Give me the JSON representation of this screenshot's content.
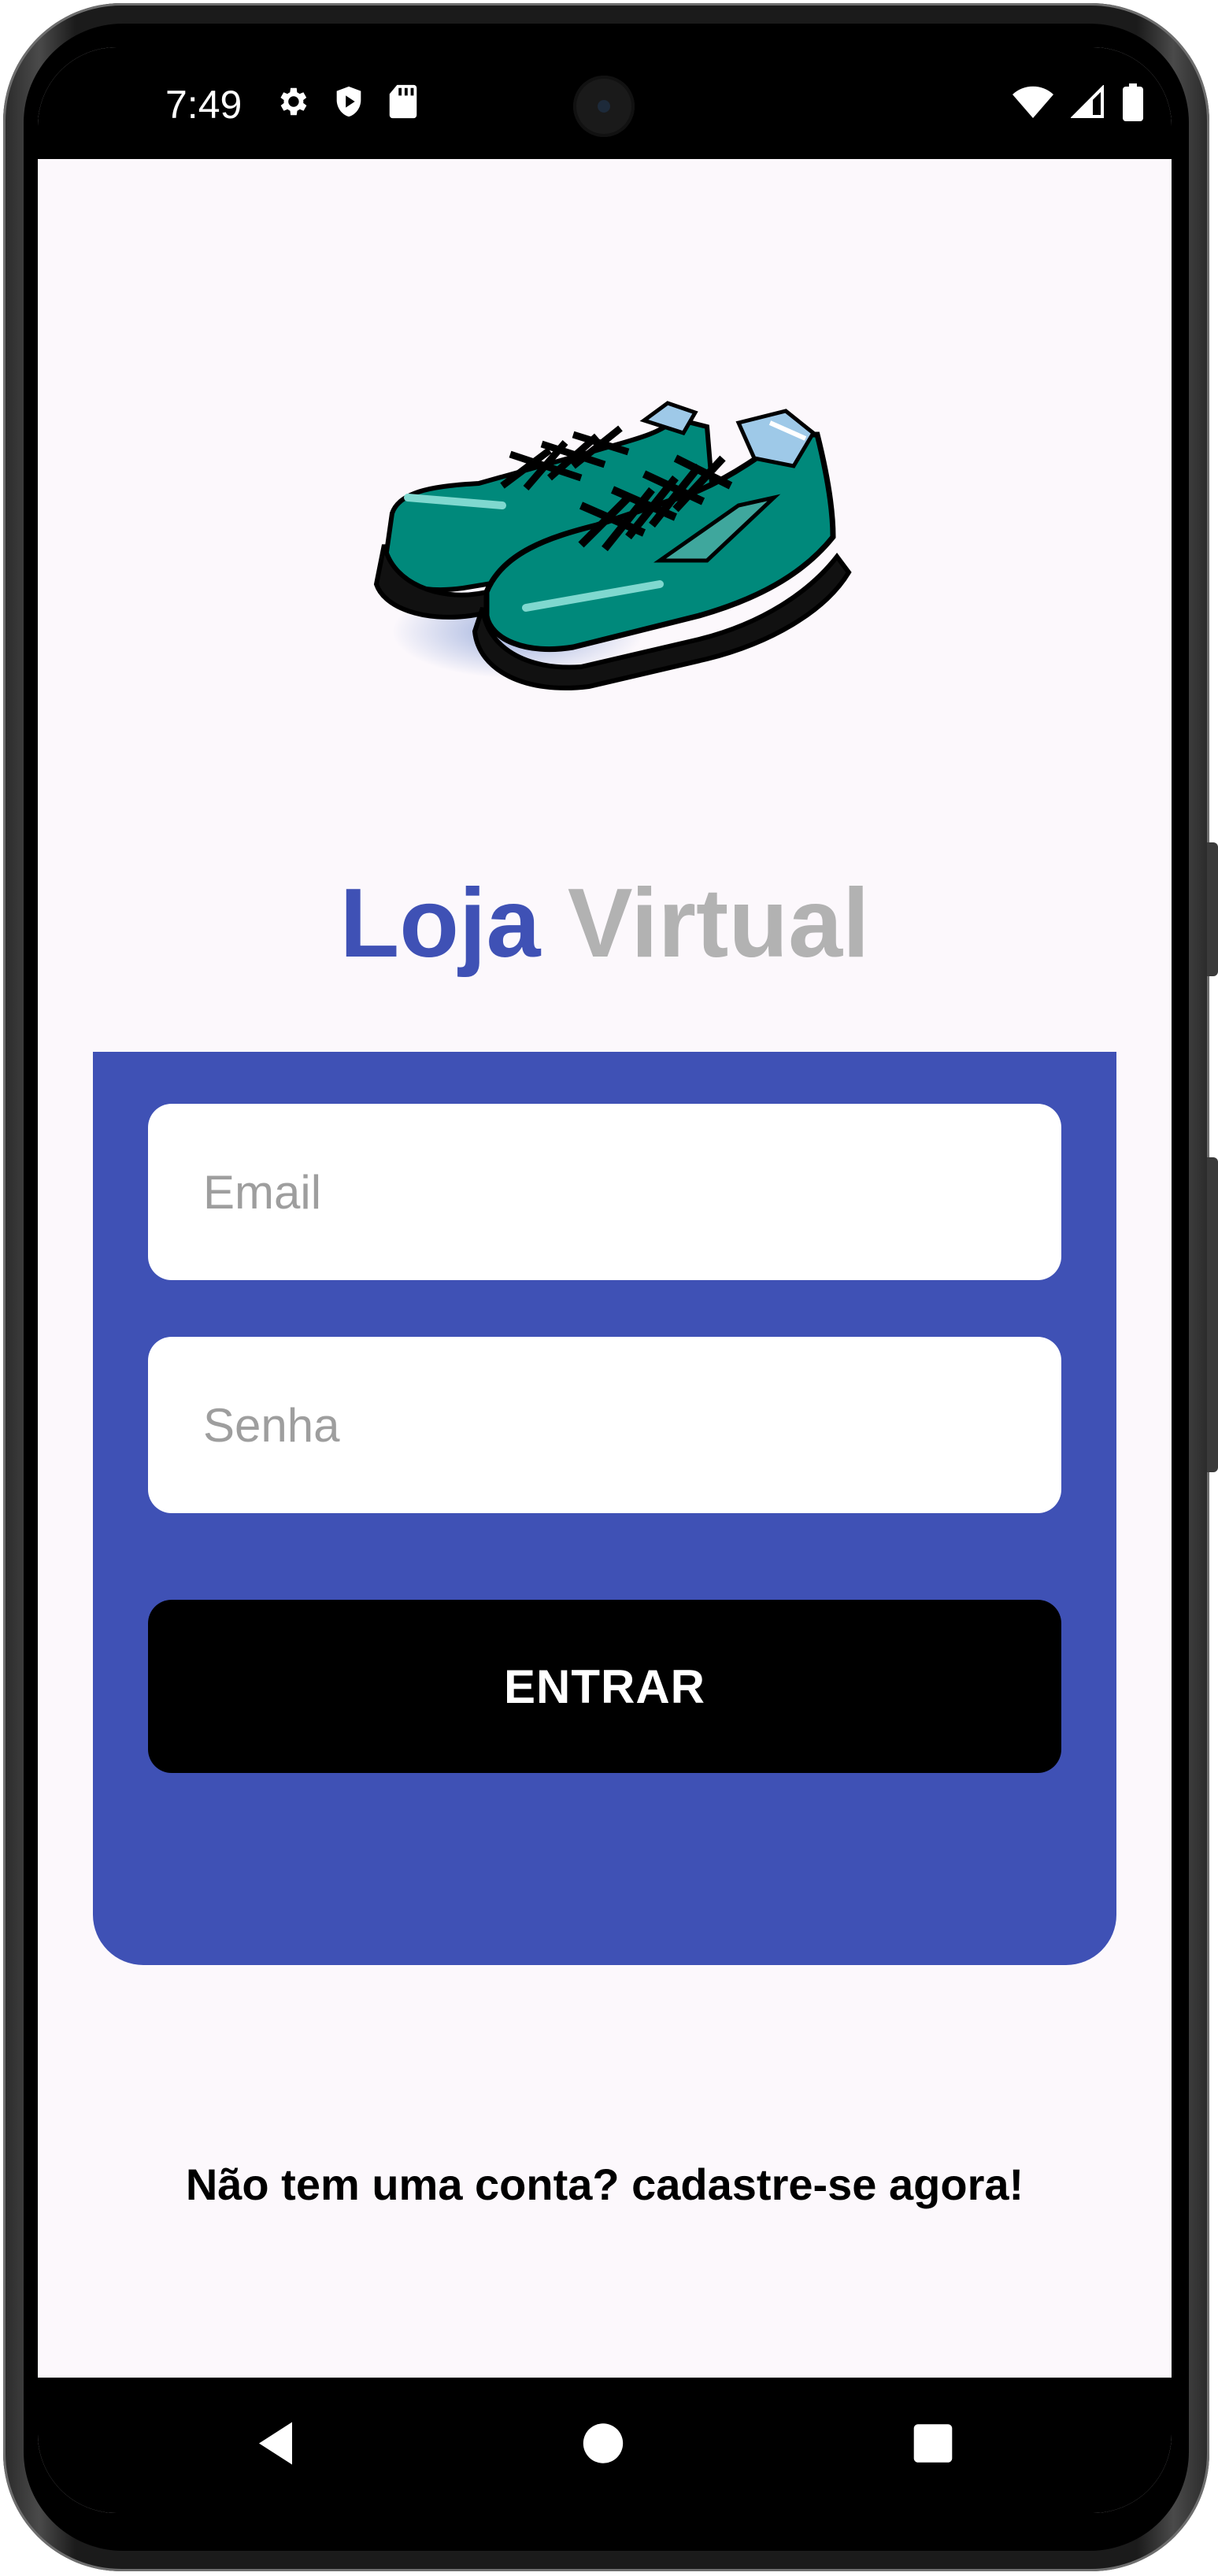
{
  "status_bar": {
    "time": "7:49",
    "left_icons": [
      "gear-icon",
      "shield-play-icon",
      "sd-card-icon"
    ],
    "right_icons": [
      "wifi-icon",
      "signal-icon",
      "battery-icon"
    ]
  },
  "logo": {
    "image": "sneakers-icon"
  },
  "title": {
    "part1": "Loja",
    "part2": "Virtual"
  },
  "form": {
    "email_placeholder": "Email",
    "password_placeholder": "Senha",
    "submit_label": "ENTRAR"
  },
  "signup_link": "Não tem uma conta? cadastre-se agora!",
  "nav_bar": {
    "buttons": [
      "back-icon",
      "home-icon",
      "recents-icon"
    ]
  },
  "colors": {
    "primary": "#3f51b5",
    "title_secondary": "#b2b2b2",
    "background": "#fcf8fc",
    "button": "#000000",
    "shoe": "#00897b"
  }
}
